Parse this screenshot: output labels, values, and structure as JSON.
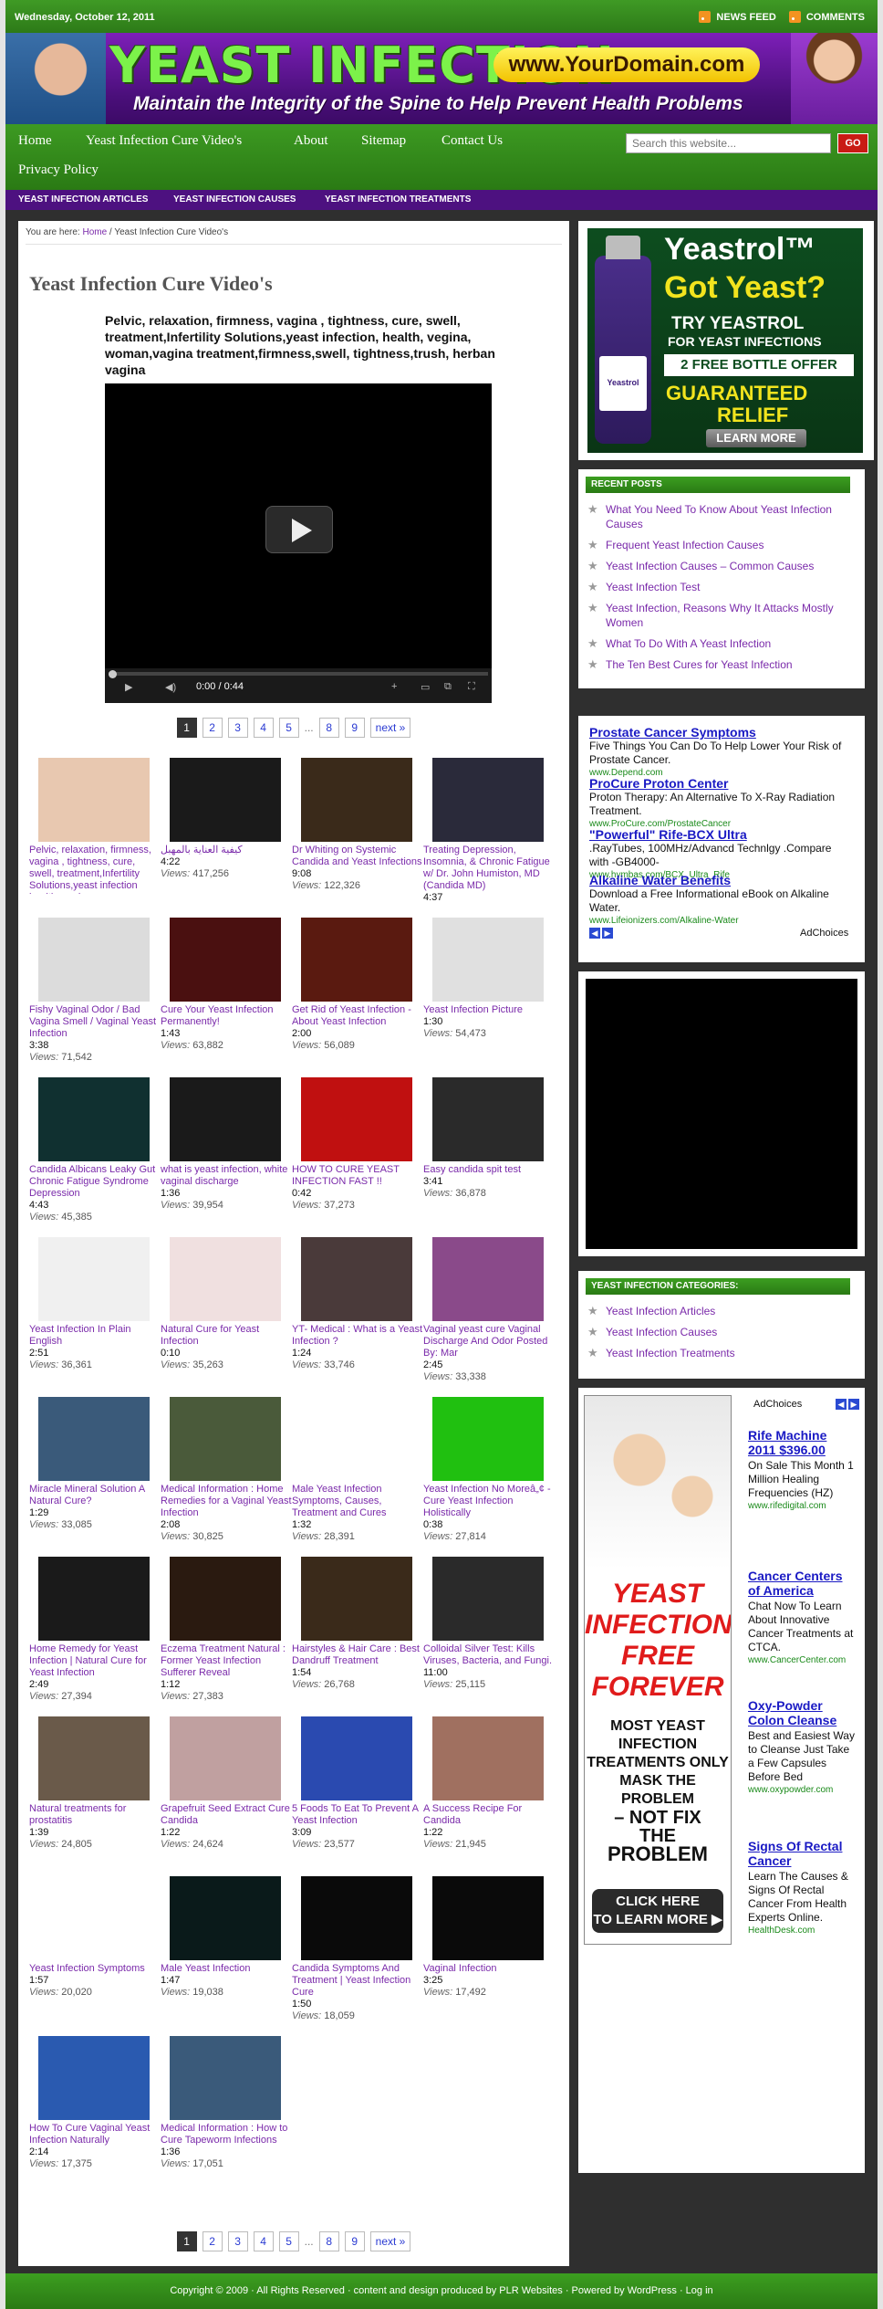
{
  "topbar": {
    "date": "Wednesday, October 12, 2011",
    "news_feed": "NEWS FEED",
    "comments": "COMMENTS"
  },
  "header": {
    "logo": "YEAST INFECTION",
    "domain": "www.YourDomain.com",
    "tagline": "Maintain the Integrity of the Spine to Help Prevent Health Problems"
  },
  "nav": {
    "items": [
      "Home",
      "Yeast Infection Cure Video's",
      "About",
      "Sitemap",
      "Contact Us",
      "Privacy Policy"
    ],
    "search_placeholder": "Search this website...",
    "go": "GO"
  },
  "subnav": [
    "YEAST INFECTION ARTICLES",
    "YEAST INFECTION CAUSES",
    "YEAST INFECTION TREATMENTS"
  ],
  "breadcrumb": {
    "prefix": "You are here:",
    "home": "Home",
    "sep": " / ",
    "current": "Yeast Infection Cure Video's"
  },
  "post": {
    "title": "Yeast Infection Cure Video's",
    "video_title": "Pelvic, relaxation, firmness, vagina , tightness, cure, swell, treatment,Infertility Solutions,yeast infection, health, vegina, woman,vagina treatment,firmness,swell, tightness,trush, herban vagina",
    "player_time": "0:00 / 0:44"
  },
  "pagination": {
    "pages": [
      "1",
      "2",
      "3",
      "4",
      "5",
      "...",
      "8",
      "9",
      "next »"
    ]
  },
  "views_label": "Views:",
  "videos": [
    {
      "title": "Pelvic, relaxation, firmness, vagina , tightness, cure, swell, treatment,Infertility Solutions,yeast infection health, vegina,",
      "duration": "",
      "views": ""
    },
    {
      "title": "كيفية العناية بالمهبل",
      "duration": "4:22",
      "views": "417,256"
    },
    {
      "title": "Dr Whiting on Systemic Candida and Yeast Infections",
      "duration": "9:08",
      "views": "122,326"
    },
    {
      "title": "Treating Depression, Insomnia, & Chronic Fatigue w/ Dr. John Humiston, MD (Candida MD)",
      "duration": "4:37",
      "views": ""
    },
    {
      "title": "Fishy Vaginal Odor / Bad Vagina Smell / Vaginal Yeast Infection",
      "duration": "3:38",
      "views": "71,542"
    },
    {
      "title": "Cure Your Yeast Infection Permanently!",
      "duration": "1:43",
      "views": "63,882"
    },
    {
      "title": "Get Rid of Yeast Infection - About Yeast Infection",
      "duration": "2:00",
      "views": "56,089"
    },
    {
      "title": "Yeast Infection Picture",
      "duration": "1:30",
      "views": "54,473"
    },
    {
      "title": "Candida Albicans Leaky Gut Chronic Fatigue Syndrome Depression",
      "duration": "4:43",
      "views": "45,385"
    },
    {
      "title": "what is yeast infection, white vaginal discharge",
      "duration": "1:36",
      "views": "39,954"
    },
    {
      "title": "HOW TO CURE YEAST INFECTION FAST !!",
      "duration": "0:42",
      "views": "37,273"
    },
    {
      "title": "Easy candida spit test",
      "duration": "3:41",
      "views": "36,878"
    },
    {
      "title": "Yeast Infection In Plain English",
      "duration": "2:51",
      "views": "36,361"
    },
    {
      "title": "Natural Cure for Yeast Infection",
      "duration": "0:10",
      "views": "35,263"
    },
    {
      "title": "YT- Medical : What is a Yeast Infection ?",
      "duration": "1:24",
      "views": "33,746"
    },
    {
      "title": "Vaginal yeast cure Vaginal Discharge And Odor Posted By: Mar",
      "duration": "2:45",
      "views": "33,338"
    },
    {
      "title": "Miracle Mineral Solution A Natural Cure?",
      "duration": "1:29",
      "views": "33,085"
    },
    {
      "title": "Medical Information : Home Remedies for a Vaginal Yeast Infection",
      "duration": "2:08",
      "views": "30,825"
    },
    {
      "title": "Male Yeast Infection Symptoms, Causes, Treatment and Cures",
      "duration": "1:32",
      "views": "28,391"
    },
    {
      "title": "Yeast Infection No Moreâ„¢ - Cure Yeast Infection Holistically",
      "duration": "0:38",
      "views": "27,814"
    },
    {
      "title": "Home Remedy for Yeast Infection | Natural Cure for Yeast Infection",
      "duration": "2:49",
      "views": "27,394"
    },
    {
      "title": "Eczema Treatment Natural : Former Yeast Infection Sufferer Reveal",
      "duration": "1:12",
      "views": "27,383"
    },
    {
      "title": "Hairstyles & Hair Care : Best Dandruff Treatment",
      "duration": "1:54",
      "views": "26,768"
    },
    {
      "title": "Colloidal Silver Test: Kills Viruses, Bacteria, and Fungi.",
      "duration": "11:00",
      "views": "25,115"
    },
    {
      "title": "Natural treatments for prostatitis",
      "duration": "1:39",
      "views": "24,805"
    },
    {
      "title": "Grapefruit Seed Extract Cure Candida",
      "duration": "1:22",
      "views": "24,624"
    },
    {
      "title": "5 Foods To Eat To Prevent A Yeast Infection",
      "duration": "3:09",
      "views": "23,577"
    },
    {
      "title": "A Success Recipe For Candida",
      "duration": "1:22",
      "views": "21,945"
    },
    {
      "title": "Yeast Infection Symptoms",
      "duration": "1:57",
      "views": "20,020"
    },
    {
      "title": "Male Yeast Infection",
      "duration": "1:47",
      "views": "19,038"
    },
    {
      "title": "Candida Symptoms And Treatment | Yeast Infection Cure",
      "duration": "1:50",
      "views": "18,059"
    },
    {
      "title": "Vaginal Infection",
      "duration": "3:25",
      "views": "17,492"
    },
    {
      "title": "How To Cure Vaginal Yeast Infection Naturally",
      "duration": "2:14",
      "views": "17,375"
    },
    {
      "title": "Medical Information : How to Cure Tapeworm Infections",
      "duration": "1:36",
      "views": "17,051"
    }
  ],
  "yeastrol_ad": {
    "brand": "Yeastrol™",
    "headline": "Got Yeast?",
    "line1": "TRY YEASTROL",
    "line2": "FOR YEAST INFECTIONS",
    "offer": "2 FREE BOTTLE OFFER",
    "guaranteed": "GUARANTEED",
    "relief": "RELIEF",
    "cta": "LEARN MORE",
    "bottle_label": "Yeastrol"
  },
  "recent_posts": {
    "heading": "RECENT POSTS",
    "items": [
      "What You Need To Know About Yeast Infection Causes",
      "Frequent Yeast Infection Causes",
      "Yeast Infection Causes – Common Causes",
      "Yeast Infection Test",
      "Yeast Infection, Reasons Why It Attacks Mostly Women",
      "What To Do With A Yeast Infection",
      "The Ten Best Cures for Yeast Infection"
    ]
  },
  "text_ads": [
    {
      "title": "Prostate Cancer Symptoms",
      "text": "Five Things You Can Do To Help Lower Your Risk of Prostate Cancer.",
      "url": "www.Depend.com"
    },
    {
      "title": "ProCure Proton Center",
      "text": "Proton Therapy: An Alternative To X-Ray Radiation Treatment.",
      "url": "www.ProCure.com/ProstateCancer"
    },
    {
      "title": "\"Powerful\" Rife-BCX Ultra",
      "text": ".RayTubes, 100MHz/Advancd Technlgy .Compare with -GB4000-",
      "url": "www.hymbas.com/BCX_Ultra_Rife"
    },
    {
      "title": "Alkaline Water Benefits",
      "text": "Download a Free Informational eBook on Alkaline Water.",
      "url": "www.Lifeionizers.com/Alkaline-Water"
    }
  ],
  "adchoices": "AdChoices",
  "categories": {
    "heading": "YEAST INFECTION CATEGORIES:",
    "items": [
      "Yeast Infection Articles",
      "Yeast Infection Causes",
      "Yeast Infection Treatments"
    ]
  },
  "banner_ad": {
    "l1": "YEAST",
    "l2": "INFECTION",
    "l3": "FREE",
    "l4": "FOREVER",
    "l5": "MOST YEAST",
    "l6": "INFECTION",
    "l7": "TREATMENTS ONLY",
    "l8": "MASK THE PROBLEM",
    "l9": "– NOT FIX",
    "l10": "THE",
    "l11": "PROBLEM",
    "cta1": "CLICK HERE",
    "cta2": "TO LEARN MORE ▶"
  },
  "side_ads": [
    {
      "title": "Rife Machine 2011 $396.00",
      "text": "On Sale This Month 1 Million Healing Frequencies (HZ)",
      "url": "www.rifedigital.com"
    },
    {
      "title": "Cancer Centers of America",
      "text": "Chat Now To Learn About Innovative Cancer Treatments at CTCA.",
      "url": "www.CancerCenter.com"
    },
    {
      "title": "Oxy-Powder Colon Cleanse",
      "text": "Best and Easiest Way to Cleanse Just Take a Few Capsules Before Bed",
      "url": "www.oxypowder.com"
    },
    {
      "title": "Signs Of Rectal Cancer",
      "text": "Learn The Causes & Signs Of Rectal Cancer From Health Experts Online.",
      "url": "HealthDesk.com"
    }
  ],
  "footer": "Copyright © 2009 · All Rights Reserved · content and design produced by PLR Websites · Powered by WordPress · Log in"
}
